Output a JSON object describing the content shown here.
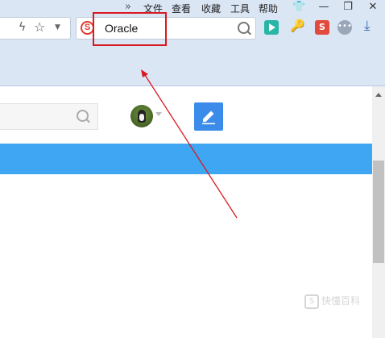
{
  "menu": {
    "overflow_glyph": "»",
    "items": [
      "文件",
      "查看",
      "收藏",
      "工具",
      "帮助"
    ],
    "window_buttons": [
      "👕",
      "—",
      "❐",
      "✕"
    ]
  },
  "search": {
    "engine_letter": "S",
    "query": "Oracle"
  },
  "toolbar": {
    "translate_label": "S"
  },
  "watermark": {
    "text": "快懂百科"
  },
  "colors": {
    "annotation_red": "#d9191f",
    "content_blue_bar": "#3ea6f3",
    "edit_button": "#3b8beb"
  }
}
